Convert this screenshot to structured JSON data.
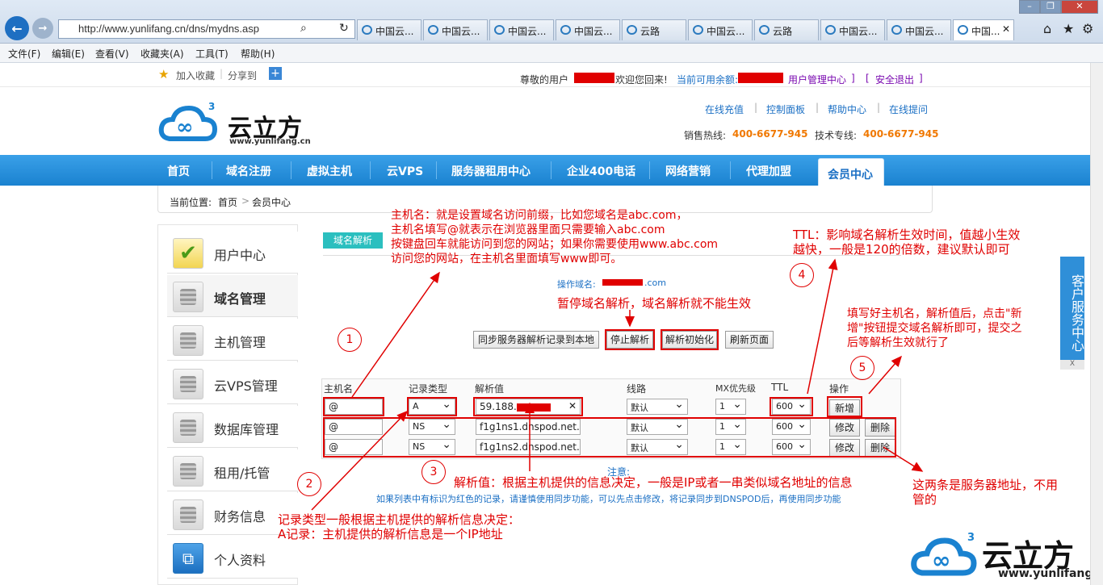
{
  "browser": {
    "url": "http://www.yunlifang.cn/dns/mydns.asp",
    "tabs": [
      "中国云...",
      "中国云...",
      "中国云...",
      "中国云...",
      "云路",
      "中国云...",
      "云路",
      "中国云...",
      "中国云...",
      "中国..."
    ],
    "menu": [
      "文件(F)",
      "编辑(E)",
      "查看(V)",
      "收藏夹(A)",
      "工具(T)",
      "帮助(H)"
    ],
    "fav_add": "加入收藏",
    "fav_share": "分享到"
  },
  "topbar": {
    "greeting_pre": "尊敬的用户",
    "greeting_post": "欢迎您回来!",
    "balance_label": "当前可用余额:",
    "user_center_link": "用户管理中心",
    "logout_link": "安全退出"
  },
  "header": {
    "logo_text": "云立方",
    "logo_url": "www.yunlifang.cn",
    "links": [
      "在线充值",
      "控制面板",
      "帮助中心",
      "在线提问"
    ],
    "sales_label": "销售热线:",
    "sales_phone": "400-6677-945",
    "tech_label": "技术专线:",
    "tech_phone": "400-6677-945"
  },
  "nav": [
    "首页",
    "域名注册",
    "虚拟主机",
    "云VPS",
    "服务器租用中心",
    "企业400电话",
    "网络营销",
    "代理加盟",
    "会员中心"
  ],
  "breadcrumb": {
    "label": "当前位置:",
    "home": "首页",
    "sep": ">",
    "current": "会员中心"
  },
  "sidebar": [
    "用户中心",
    "域名管理",
    "主机管理",
    "云VPS管理",
    "数据库管理",
    "租用/托管",
    "财务信息",
    "个人资料"
  ],
  "panel": {
    "tab": "域名解析",
    "domain_label": "操作域名:",
    "domain_suffix": ".com",
    "buttons": [
      "同步服务器解析记录到本地",
      "停止解析",
      "解析初始化",
      "刷新页面"
    ],
    "columns": [
      "主机名",
      "记录类型",
      "解析值",
      "线路",
      "MX优先级",
      "TTL",
      "操作"
    ],
    "new_row": {
      "host": "@",
      "type": "A",
      "value": "59.188.",
      "line": "默认",
      "mx": "1",
      "ttl": "600",
      "action": "新增"
    },
    "rows": [
      {
        "host": "@",
        "type": "NS",
        "value": "f1g1ns1.dnspod.net.",
        "line": "默认",
        "mx": "1",
        "ttl": "600",
        "edit": "修改",
        "del": "删除"
      },
      {
        "host": "@",
        "type": "NS",
        "value": "f1g1ns2.dnspod.net.",
        "line": "默认",
        "mx": "1",
        "ttl": "600",
        "edit": "修改",
        "del": "删除"
      }
    ],
    "note_title": "注意:",
    "note_text": "如果列表中有标识为红色的记录，请谨慎使用同步功能，可以先点击修改，将记录同步到DNSPOD后，再使用同步功能"
  },
  "annotations": {
    "a1_line1": "主机名：就是设置域名访问前缀，比如您域名是abc.com，",
    "a1_line2": "主机名填写@就表示在浏览器里面只需要输入abc.com",
    "a1_line3": "按键盘回车就能访问到您的网站；如果你需要使用www.abc.com",
    "a1_line4": "访问您的网站，在主机名里面填写www即可。",
    "a_stop": "暂停域名解析，域名解析就不能生效",
    "a_ttl1": "TTL：影响域名解析生效时间，值越小生效",
    "a_ttl2": "越快，一般是120的倍数，建议默认即可",
    "a_add1": "填写好主机名，解析值后，点击\"新",
    "a_add2": "增\"按钮提交域名解析即可，提交之",
    "a_add3": "后等解析生效就行了",
    "a_value": "解析值：根据主机提供的信息决定，一般是IP或者一串类似域名地址的信息",
    "a_type1": "记录类型一般根据主机提供的解析信息决定：",
    "a_type2": "A记录：主机提供的解析信息是一个IP地址",
    "a_server1": "这两条是服务器地址，不用",
    "a_server2": "管的",
    "n1": "1",
    "n2": "2",
    "n3": "3",
    "n4": "4",
    "n5": "5"
  },
  "float_service": "客户服务中心",
  "float_close": "X",
  "watermark_text": "云立方",
  "watermark_url": "www.yunlifang.cn"
}
